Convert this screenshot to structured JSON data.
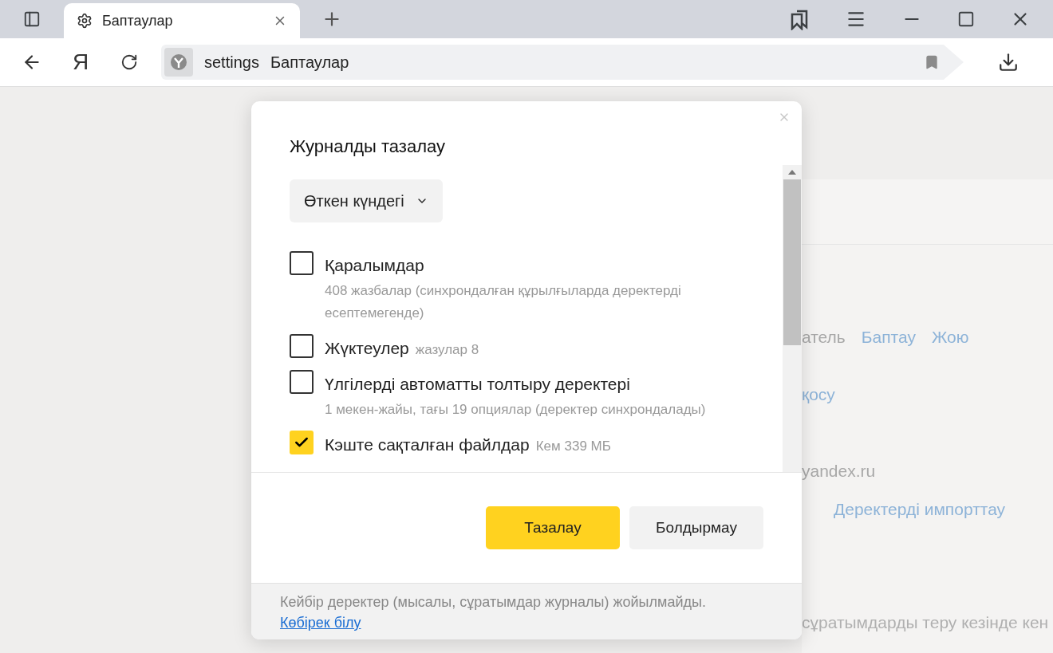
{
  "tab": {
    "title": "Баптаулар",
    "selected": true
  },
  "address": {
    "scheme": "settings",
    "title": "Баптаулар"
  },
  "logo": "Я",
  "background": {
    "row_1": "атель",
    "link_1": "Баптау",
    "link_2": "Жою",
    "link_3": "қосу",
    "email": "yandex.ru",
    "link_4": "Деректерді импорттау",
    "text_1": "сұратымдарды теру кезінде кен"
  },
  "dialog": {
    "title": "Журналды тазалау",
    "period": "Өткен күндегі",
    "items": [
      {
        "kind": "block",
        "label": "Қаралымдар",
        "note": "408 жазбалар (синхрондалған құрылғыларда деректерді есептемегенде)",
        "checked": false
      },
      {
        "kind": "inline",
        "label": "Жүктеулер",
        "note": "жазулар 8",
        "checked": false
      },
      {
        "kind": "block",
        "label": "Үлгілерді автоматты толтыру деректері",
        "note": "1 мекен-жайы, тағы 19 опциялар (деректер синхрондалады)",
        "checked": false
      },
      {
        "kind": "inline",
        "label": "Кэште сақталған файлдар",
        "note": "Кем 339 МБ",
        "checked": true
      }
    ],
    "buttons": [
      {
        "kind": "primary",
        "label": "Тазалау"
      },
      {
        "kind": "secondary",
        "label": "Болдырмау"
      }
    ],
    "footer": "Кейбір деректер (мысалы, сұратымдар журналы) жойылмайды.",
    "footer_link": "Көбірек білу"
  }
}
